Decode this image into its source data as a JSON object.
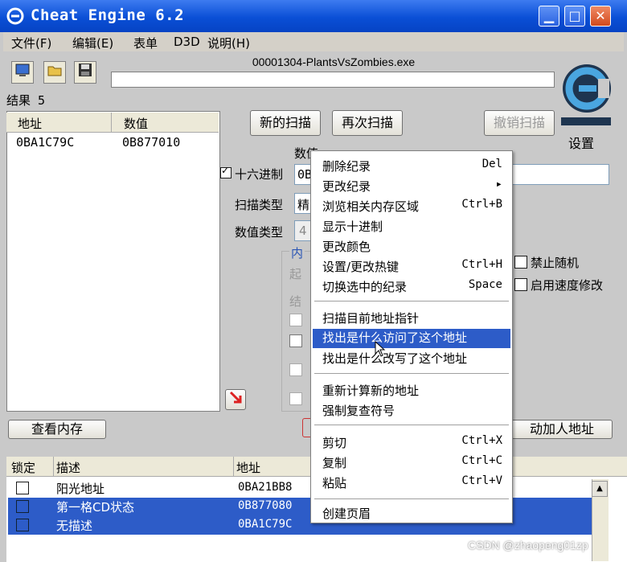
{
  "window": {
    "title": "Cheat Engine 6.2",
    "minimize": "▁",
    "maximize": "□",
    "close": "✕"
  },
  "menu": {
    "items": [
      "文件(F)",
      "编辑(E)",
      "表单",
      "D3D",
      "说明(H)"
    ]
  },
  "toolbar": {
    "icons": [
      "open-process-icon",
      "open-file-icon",
      "save-icon"
    ]
  },
  "process": {
    "name": "00001304-PlantsVsZombies.exe"
  },
  "settings_label": "设置",
  "results": {
    "label": "结果 5"
  },
  "found_list": {
    "headers": [
      "地址",
      "数值"
    ],
    "rows": [
      {
        "address": "0BA1C79C",
        "value": "0B877010"
      }
    ]
  },
  "scan": {
    "new_scan": "新的扫描",
    "next_scan": "再次扫描",
    "undo_scan": "撤销扫描",
    "value_label": "数值",
    "hex_label": "十六进制",
    "hex_value": "0B",
    "scan_type_label": "扫描类型",
    "scan_type_value": "精",
    "value_type_label": "数值类型",
    "value_type_value": "4",
    "memory_group": "内",
    "start_label": "起",
    "end_label": "结",
    "disable_random": "禁止随机",
    "enable_speedhack": "启用速度修改"
  },
  "view_memory": "查看内存",
  "add_address": "动加人地址",
  "cheat_table": {
    "headers": [
      "锁定",
      "描述",
      "地址"
    ],
    "rows": [
      {
        "description": "阳光地址",
        "address": "0BA21BB8",
        "selected": false
      },
      {
        "description": "第一格CD状态",
        "address": "0B877080",
        "selected": true
      },
      {
        "description": "无描述",
        "address": "0BA1C79C",
        "selected": true
      }
    ]
  },
  "context_menu": {
    "groups": [
      [
        {
          "label": "删除纪录",
          "shortcut": "Del"
        },
        {
          "label": "更改纪录",
          "shortcut": "▸"
        },
        {
          "label": "浏览相关内存区域",
          "shortcut": "Ctrl+B"
        },
        {
          "label": "显示十进制",
          "shortcut": ""
        },
        {
          "label": "更改颜色",
          "shortcut": ""
        },
        {
          "label": "设置/更改热键",
          "shortcut": "Ctrl+H"
        },
        {
          "label": "切换选中的纪录",
          "shortcut": "Space"
        }
      ],
      [
        {
          "label": "扫描目前地址指针",
          "shortcut": ""
        },
        {
          "label": "找出是什么访问了这个地址",
          "shortcut": "",
          "highlighted": true
        },
        {
          "label": "找出是什么改写了这个地址",
          "shortcut": ""
        }
      ],
      [
        {
          "label": "重新计算新的地址",
          "shortcut": ""
        },
        {
          "label": "强制复查符号",
          "shortcut": ""
        }
      ],
      [
        {
          "label": "剪切",
          "shortcut": "Ctrl+X"
        },
        {
          "label": "复制",
          "shortcut": "Ctrl+C"
        },
        {
          "label": "粘贴",
          "shortcut": "Ctrl+V"
        }
      ],
      [
        {
          "label": "创建页眉",
          "shortcut": ""
        }
      ]
    ]
  },
  "watermark": "CSDN @zhaopeng01zp",
  "colors": {
    "titlebar": "#0a4fd6",
    "selection": "#2d5cc8",
    "window_bg": "#d4d0c8"
  }
}
